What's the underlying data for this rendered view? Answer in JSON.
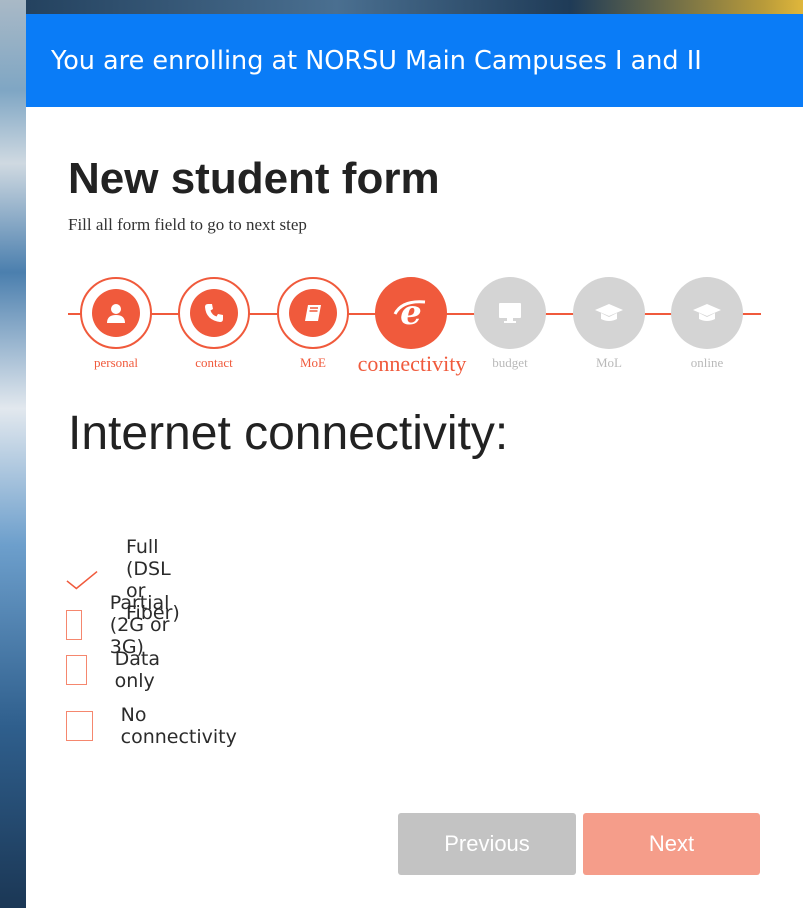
{
  "banner": {
    "text": "You are enrolling at NORSU Main Campuses I and II"
  },
  "form": {
    "title": "New student form",
    "subtitle": "Fill all form field to go to next step"
  },
  "steps": [
    {
      "label": "personal",
      "icon": "user-icon",
      "state": "done"
    },
    {
      "label": "contact",
      "icon": "phone-icon",
      "state": "done"
    },
    {
      "label": "MoE",
      "icon": "book-icon",
      "state": "done"
    },
    {
      "label": "connectivity",
      "icon": "internet-explorer-icon",
      "state": "active"
    },
    {
      "label": "budget",
      "icon": "monitor-icon",
      "state": "todo"
    },
    {
      "label": "MoL",
      "icon": "graduation-cap-icon",
      "state": "todo"
    },
    {
      "label": "online",
      "icon": "graduation-cap-icon",
      "state": "todo"
    }
  ],
  "section": {
    "title": "Internet connectivity:"
  },
  "options": [
    {
      "label": "Full (DSL or Fiber)",
      "checked": true
    },
    {
      "label": "Partial (2G or 3G)",
      "checked": false
    },
    {
      "label": "Data only",
      "checked": false
    },
    {
      "label": "No connectivity",
      "checked": false
    }
  ],
  "buttons": {
    "previous": "Previous",
    "next": "Next"
  },
  "colors": {
    "banner": "#0a7cf7",
    "accent": "#f05a3c",
    "inactive_step": "#d4d4d4",
    "previous_button": "#c3c3c3",
    "next_button": "#f59d8a"
  }
}
